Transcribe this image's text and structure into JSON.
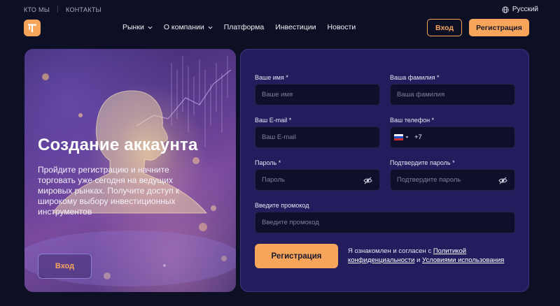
{
  "topbar": {
    "about": "КТО МЫ",
    "separator": "|",
    "contacts": "КОНТАКТЫ",
    "language": "Русский"
  },
  "nav": {
    "items": [
      {
        "label": "Рынки",
        "dropdown": true
      },
      {
        "label": "О компании",
        "dropdown": true
      },
      {
        "label": "Платформа",
        "dropdown": false
      },
      {
        "label": "Инвестиции",
        "dropdown": false
      },
      {
        "label": "Новости",
        "dropdown": false
      }
    ],
    "login_label": "Вход",
    "register_label": "Регистрация"
  },
  "hero": {
    "title": "Создание аккаунта",
    "text": "Пройдите регистрацию и начните торговать уже сегодня на ведущих мировых рынках. Получите доступ к широкому выбору инвестиционных инструментов",
    "login_label": "Вход"
  },
  "form": {
    "first_name": {
      "label": "Ваше имя *",
      "placeholder": "Ваше имя"
    },
    "last_name": {
      "label": "Ваша фамилия *",
      "placeholder": "Ваша фамилия"
    },
    "email": {
      "label": "Ваш E-mail *",
      "placeholder": "Ваш E-mail"
    },
    "phone": {
      "label": "Ваш телефон *",
      "code": "+7"
    },
    "password": {
      "label": "Пароль *",
      "placeholder": "Пароль"
    },
    "password_confirm": {
      "label": "Подтвердите пароль *",
      "placeholder": "Подтвердите пароль"
    },
    "promo": {
      "label": "Введите промокод",
      "placeholder": "Введите промокод"
    },
    "submit_label": "Регистрация",
    "consent": {
      "prefix": "Я ознакомлен и согласен с ",
      "privacy_link": "Политикой конфиденциальности",
      "middle": " и ",
      "terms_link": "Условиями использования"
    }
  },
  "colors": {
    "background": "#0d0f24",
    "accent": "#f7a55a",
    "card": "#231d5d",
    "input": "#100f2b"
  }
}
